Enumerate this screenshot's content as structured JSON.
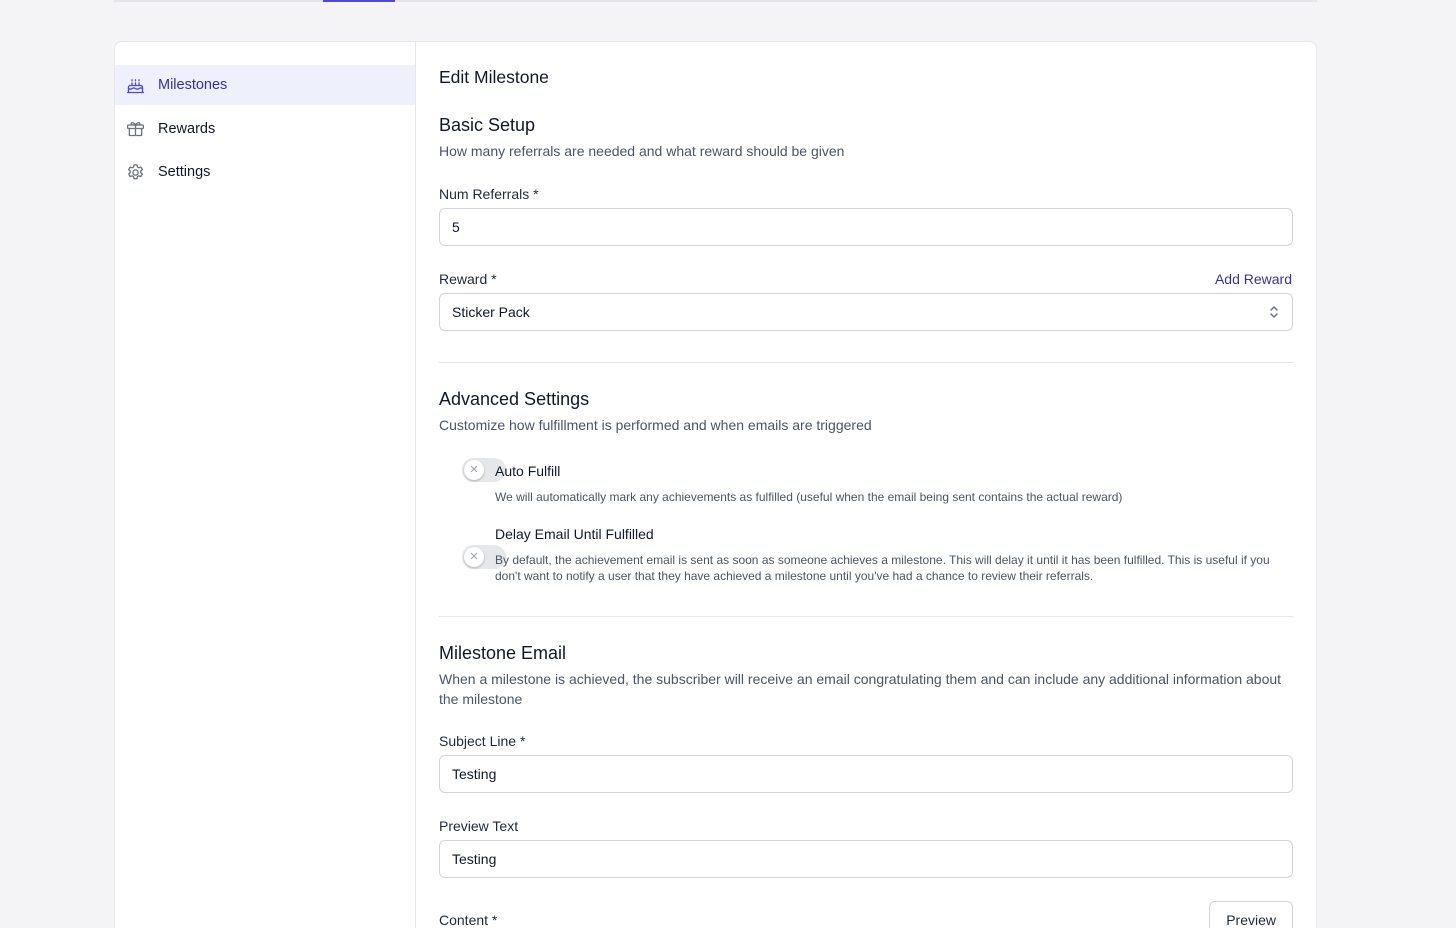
{
  "sidebar": {
    "items": [
      {
        "label": "Milestones",
        "icon": "cake-icon",
        "active": true
      },
      {
        "label": "Rewards",
        "icon": "gift-icon",
        "active": false
      },
      {
        "label": "Settings",
        "icon": "gear-icon",
        "active": false
      }
    ]
  },
  "page": {
    "title": "Edit Milestone"
  },
  "basic_setup": {
    "title": "Basic Setup",
    "description": "How many referrals are needed and what reward should be given",
    "num_referrals": {
      "label": "Num Referrals *",
      "value": "5"
    },
    "reward": {
      "label": "Reward *",
      "value": "Sticker Pack",
      "add_link": "Add Reward"
    }
  },
  "advanced": {
    "title": "Advanced Settings",
    "description": "Customize how fulfillment is performed and when emails are triggered",
    "auto_fulfill": {
      "label": "Auto Fulfill",
      "enabled": false,
      "description": "We will automatically mark any achievements as fulfilled (useful when the email being sent contains the actual reward)"
    },
    "delay_email": {
      "label": "Delay Email Until Fulfilled",
      "enabled": false,
      "description": "By default, the achievement email is sent as soon as someone achieves a milestone. This will delay it until it has been fulfilled. This is useful if you don't want to notify a user that they have achieved a milestone until you've had a chance to review their referrals."
    }
  },
  "milestone_email": {
    "title": "Milestone Email",
    "description": "When a milestone is achieved, the subscriber will receive an email congratulating them and can include any additional information about the milestone",
    "subject": {
      "label": "Subject Line *",
      "value": "Testing"
    },
    "preview_text": {
      "label": "Preview Text",
      "value": "Testing"
    },
    "content": {
      "label": "Content *"
    },
    "preview_button": "Preview"
  },
  "colors": {
    "accent": "#4f46e5",
    "active_bg": "#eef0fb",
    "active_text": "#3730a3"
  }
}
